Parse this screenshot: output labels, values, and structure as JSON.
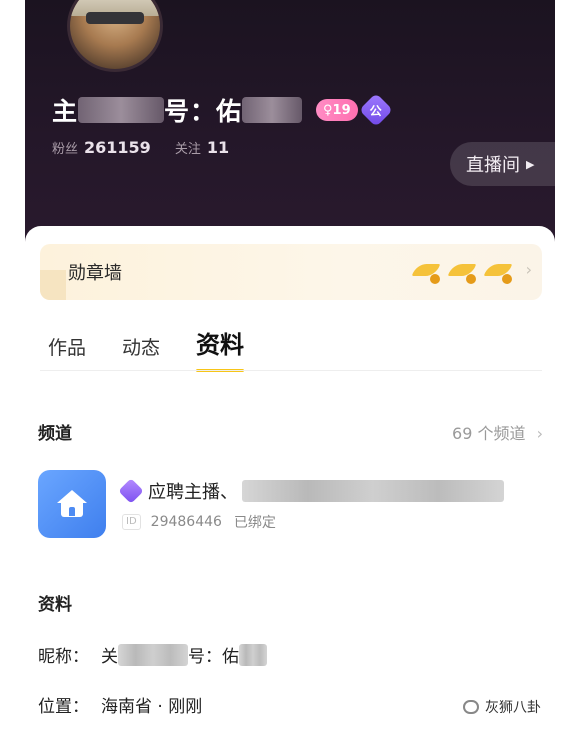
{
  "profile": {
    "username_start": "主",
    "username_end": "号：佑",
    "level": "♀19",
    "official_label": "公",
    "fans_label": "粉丝",
    "fans_value": "261159",
    "following_label": "关注",
    "following_value": "11",
    "live_button": "直播间"
  },
  "medal_wall": {
    "title": "勋章墙",
    "medals": [
      "wing-medal",
      "wing-medal",
      "wing-medal"
    ]
  },
  "tabs": [
    {
      "label": "作品",
      "active": false
    },
    {
      "label": "动态",
      "active": false
    },
    {
      "label": "资料",
      "active": true
    }
  ],
  "channels": {
    "title": "频道",
    "count_text": "69 个频道",
    "item": {
      "name": "应聘主播、",
      "id_tag": "ID",
      "id": "29486446",
      "status": "已绑定"
    }
  },
  "info": {
    "title": "资料",
    "nickname_label": "昵称：",
    "nickname_start": "关",
    "nickname_end": "号：佑",
    "location_label": "位置：",
    "location_value": "海南省 · 刚刚"
  },
  "watermark": "灰狮八卦",
  "colors": {
    "header_bg": "#241729",
    "accent_yellow": "#f7c518",
    "channel_icon": "#4d8bf3",
    "level_pink": "#ff7ab8",
    "official_purple": "#7b4ff0"
  }
}
